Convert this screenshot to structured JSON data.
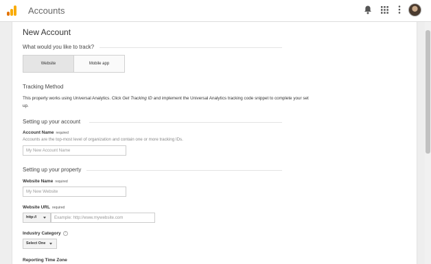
{
  "header": {
    "app_title": "Accounts",
    "icons": [
      "notifications-icon",
      "apps-grid-icon",
      "more-vert-icon",
      "avatar"
    ]
  },
  "form": {
    "title": "New Account",
    "track_heading": "What would you like to track?",
    "track_options": [
      "Website",
      "Mobile app"
    ],
    "selected_track": "Website",
    "tracking_method": {
      "heading": "Tracking Method",
      "text_before": "This property works using Universal Analytics. Click ",
      "text_link": "Get Tracking ID",
      "text_after": " and implement the Universal Analytics tracking code snippet to complete your set up."
    },
    "account_section": {
      "heading": "Setting up your account",
      "name_label": "Account Name",
      "required": "required",
      "help": "Accounts are the top-most level of organization and contain one or more tracking IDs.",
      "name_placeholder": "My New Account Name"
    },
    "property_section": {
      "heading": "Setting up your property",
      "website_name_label": "Website Name",
      "required": "required",
      "website_name_placeholder": "My New Website",
      "website_url_label": "Website URL",
      "protocol_value": "http://",
      "url_placeholder": "Example: http://www.mywebsite.com",
      "industry_label": "Industry Category",
      "industry_help_icon": "help-icon",
      "industry_value": "Select One",
      "timezone_label": "Reporting Time Zone"
    }
  },
  "colors": {
    "logo_dark": "#e37400",
    "logo_light": "#f9ab00",
    "page_bg": "#eeeeee"
  }
}
